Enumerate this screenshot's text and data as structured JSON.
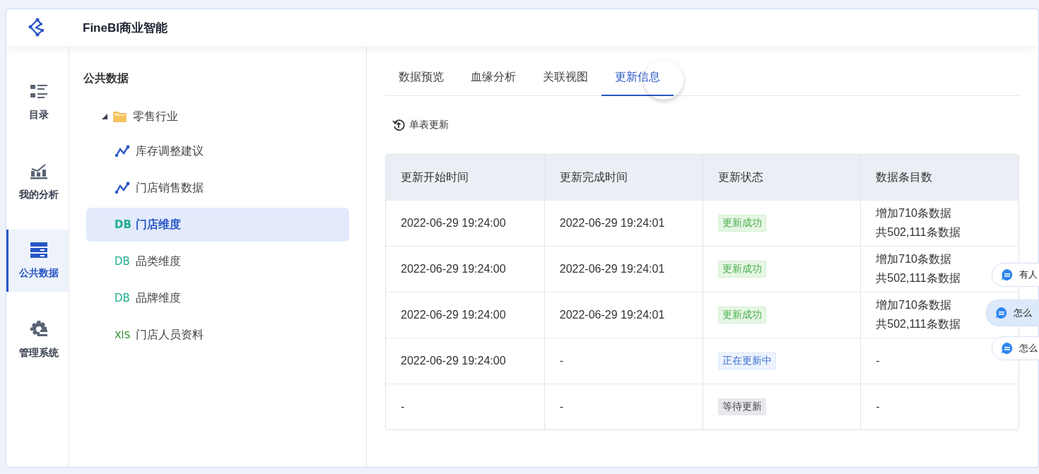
{
  "header": {
    "title": "FineBI商业智能"
  },
  "rail": [
    {
      "kind": "catalog",
      "label": "目录",
      "selected": false
    },
    {
      "kind": "analysis",
      "label": "我的分析",
      "selected": false
    },
    {
      "kind": "public",
      "label": "公共数据",
      "selected": true
    },
    {
      "kind": "admin",
      "label": "管理系统",
      "selected": false
    }
  ],
  "tree": {
    "title": "公共数据",
    "items": [
      {
        "kind": "folder",
        "label": "零售行业",
        "expanded": true,
        "children": [
          {
            "kind": "analysis",
            "label": "库存调整建议",
            "selected": false
          },
          {
            "kind": "analysis",
            "label": "门店销售数据",
            "selected": false
          },
          {
            "kind": "db",
            "badge": "DB",
            "label": "门店维度",
            "selected": true
          },
          {
            "kind": "db",
            "badge": "DB",
            "label": "品类维度",
            "selected": false
          },
          {
            "kind": "db",
            "badge": "DB",
            "label": "品牌维度",
            "selected": false
          },
          {
            "kind": "xls",
            "badge": "XlS",
            "label": "门店人员资料",
            "selected": false
          }
        ]
      }
    ]
  },
  "tabs": [
    {
      "label": "数据预览",
      "selected": false
    },
    {
      "label": "血缘分析",
      "selected": false
    },
    {
      "label": "关联视图",
      "selected": false
    },
    {
      "label": "更新信息",
      "selected": true
    }
  ],
  "toolbar": {
    "button": "单表更新"
  },
  "table": {
    "columns": [
      "更新开始时间",
      "更新完成时间",
      "更新状态",
      "数据条目数"
    ],
    "rows": [
      {
        "start": "2022-06-29 19:24:00",
        "end": "2022-06-29 19:24:01",
        "status": {
          "kind": "success",
          "label": "更新成功"
        },
        "count": [
          "增加710条数据",
          "共502,111条数据"
        ]
      },
      {
        "start": "2022-06-29 19:24:00",
        "end": "2022-06-29 19:24:01",
        "status": {
          "kind": "success",
          "label": "更新成功"
        },
        "count": [
          "增加710条数据",
          "共502,111条数据"
        ]
      },
      {
        "start": "2022-06-29 19:24:00",
        "end": "2022-06-29 19:24:01",
        "status": {
          "kind": "success",
          "label": "更新成功"
        },
        "count": [
          "增加710条数据",
          "共502,111条数据"
        ]
      },
      {
        "start": "2022-06-29 19:24:00",
        "end": "-",
        "status": {
          "kind": "running",
          "label": "正在更新中"
        },
        "count": [
          "-"
        ]
      },
      {
        "start": "-",
        "end": "-",
        "status": {
          "kind": "waiting",
          "label": "等待更新"
        },
        "count": [
          "-"
        ]
      }
    ]
  },
  "chat_bubbles": [
    {
      "label": "有人",
      "selected": false
    },
    {
      "label": "怎么",
      "selected": true
    },
    {
      "label": "怎么",
      "selected": false
    }
  ]
}
